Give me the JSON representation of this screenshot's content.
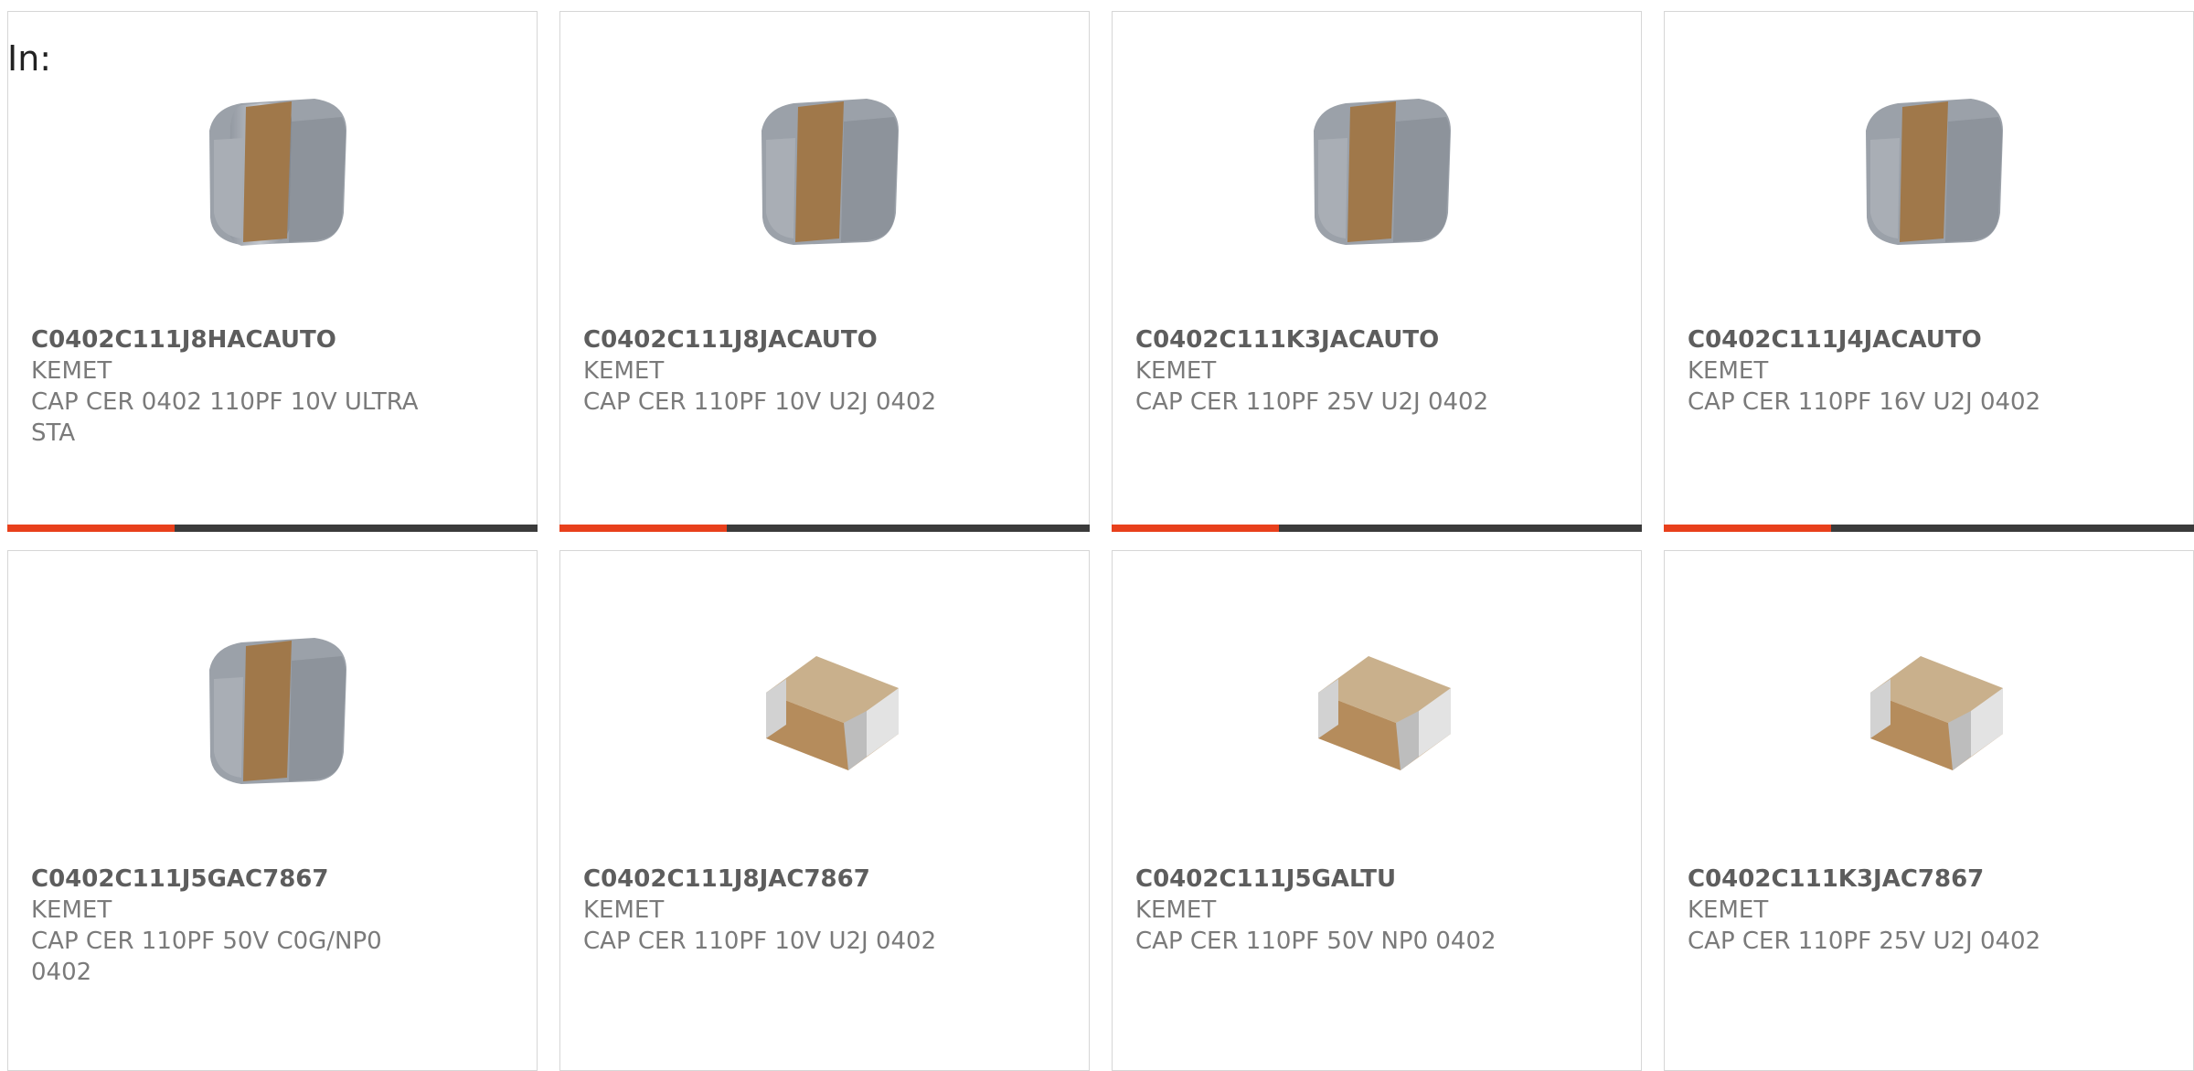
{
  "filter": {
    "label": "In:"
  },
  "products": [
    {
      "part_number": "C0402C111J8HACAUTO",
      "manufacturer": "KEMET",
      "description": "CAP CER 0402 110PF 10V ULTRA STA",
      "image": "capacitor-automotive-icon"
    },
    {
      "part_number": "C0402C111J8JACAUTO",
      "manufacturer": "KEMET",
      "description": "CAP CER 110PF 10V U2J 0402",
      "image": "capacitor-automotive-icon"
    },
    {
      "part_number": "C0402C111K3JACAUTO",
      "manufacturer": "KEMET",
      "description": "CAP CER 110PF 25V U2J 0402",
      "image": "capacitor-automotive-icon"
    },
    {
      "part_number": "C0402C111J4JACAUTO",
      "manufacturer": "KEMET",
      "description": "CAP CER 110PF 16V U2J 0402",
      "image": "capacitor-automotive-icon"
    },
    {
      "part_number": "C0402C111J5GAC7867",
      "manufacturer": "KEMET",
      "description": "CAP CER 110PF 50V C0G/NP0 0402",
      "image": "capacitor-automotive-icon"
    },
    {
      "part_number": "C0402C111J8JAC7867",
      "manufacturer": "KEMET",
      "description": "CAP CER 110PF 10V U2J 0402",
      "image": "capacitor-standard-icon"
    },
    {
      "part_number": "C0402C111J5GALTU",
      "manufacturer": "KEMET",
      "description": "CAP CER 110PF 50V NP0 0402",
      "image": "capacitor-standard-icon"
    },
    {
      "part_number": "C0402C111K3JAC7867",
      "manufacturer": "KEMET",
      "description": "CAP CER 110PF 25V U2J 0402",
      "image": "capacitor-standard-icon"
    }
  ],
  "colors": {
    "accent": "#e8401c",
    "bar_dark": "#3b3b3b",
    "part_number": "#5d5d5d",
    "text": "#7a7a7a"
  }
}
